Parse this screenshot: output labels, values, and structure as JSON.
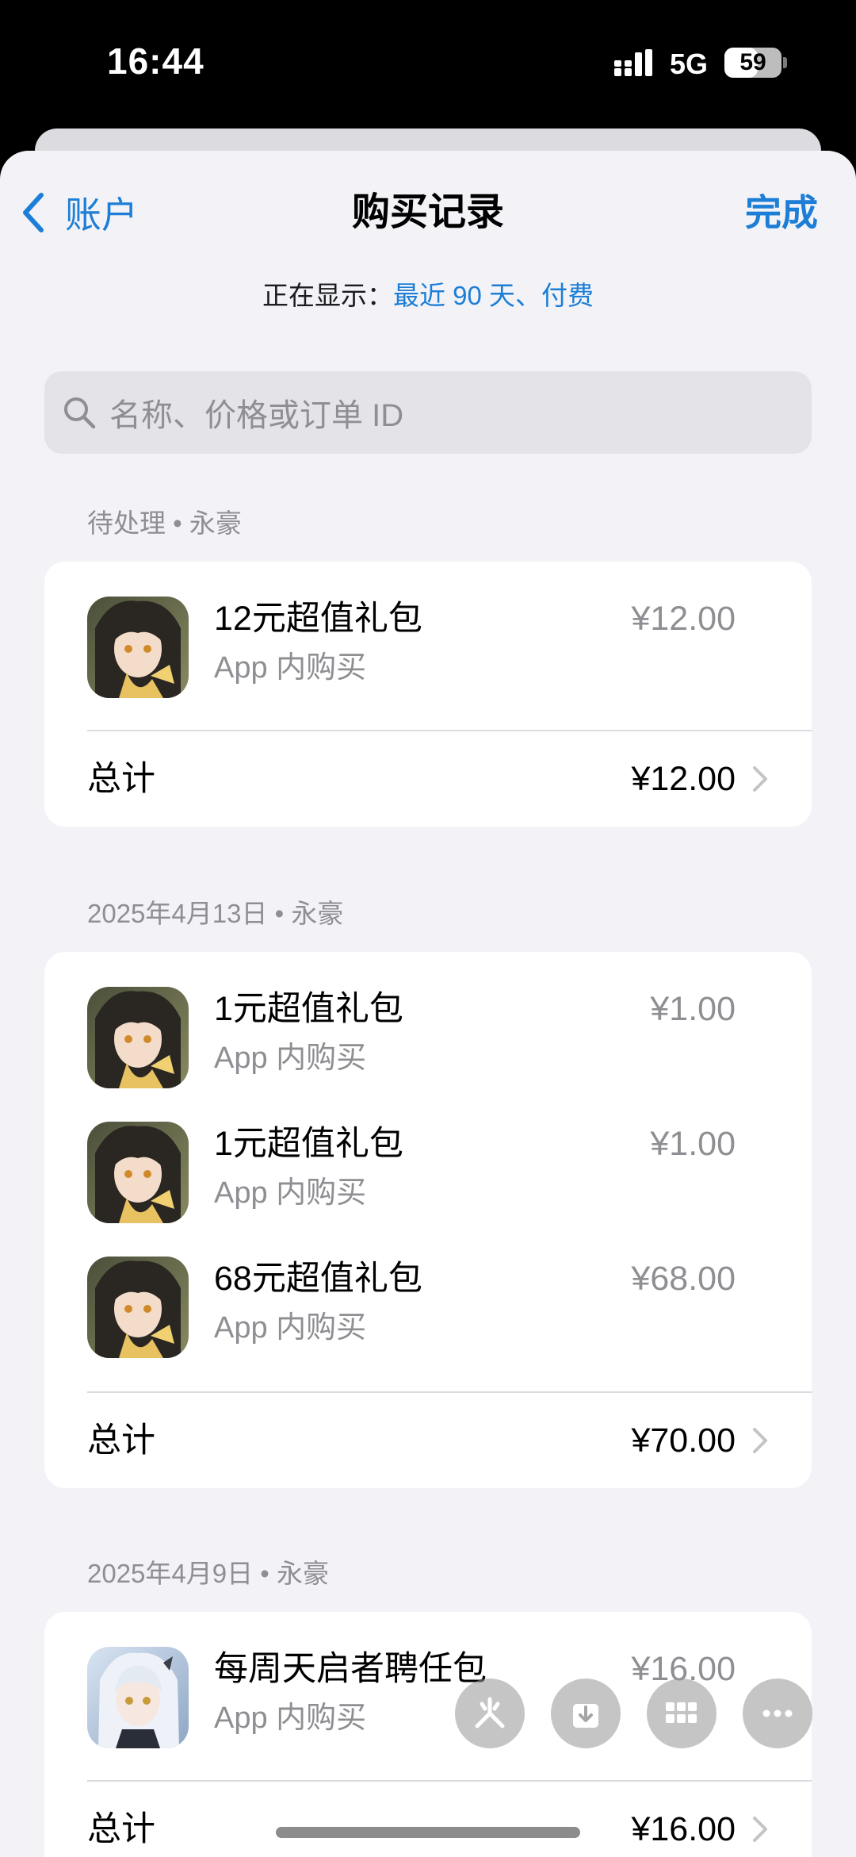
{
  "status_bar": {
    "time": "16:44",
    "network": "5G",
    "battery": "59",
    "battery_level": 0.59
  },
  "nav": {
    "back_label": "账户",
    "title": "购买记录",
    "done_label": "完成"
  },
  "filter": {
    "prefix": "正在显示：",
    "value": "最近 90 天、付费"
  },
  "search": {
    "placeholder": "名称、价格或订单 ID"
  },
  "sections": [
    {
      "header": "待处理 • 永豪",
      "items": [
        {
          "title": "12元超值礼包",
          "subtitle": "App 内购买",
          "price": "¥12.00",
          "icon": "game-icon-dark-haired-character"
        }
      ],
      "total_label": "总计",
      "total": "¥12.00"
    },
    {
      "header": "2025年4月13日 • 永豪",
      "items": [
        {
          "title": "1元超值礼包",
          "subtitle": "App 内购买",
          "price": "¥1.00",
          "icon": "game-icon-dark-haired-character"
        },
        {
          "title": "1元超值礼包",
          "subtitle": "App 内购买",
          "price": "¥1.00",
          "icon": "game-icon-dark-haired-character"
        },
        {
          "title": "68元超值礼包",
          "subtitle": "App 内购买",
          "price": "¥68.00",
          "icon": "game-icon-dark-haired-character"
        }
      ],
      "total_label": "总计",
      "total": "¥70.00"
    },
    {
      "header": "2025年4月9日 • 永豪",
      "items": [
        {
          "title": "每周天启者聘任包",
          "subtitle": "App 内购买",
          "price": "¥16.00",
          "icon": "game-icon-white-haired-character"
        }
      ],
      "total_label": "总计",
      "total": "¥16.00"
    }
  ],
  "floating_buttons": [
    "sparkle-icon",
    "download-icon",
    "grid-icon",
    "more-icon"
  ],
  "colors": {
    "accent": "#1c7ed6",
    "background": "#f2f2f7",
    "secondary_text": "#8e8e93"
  }
}
